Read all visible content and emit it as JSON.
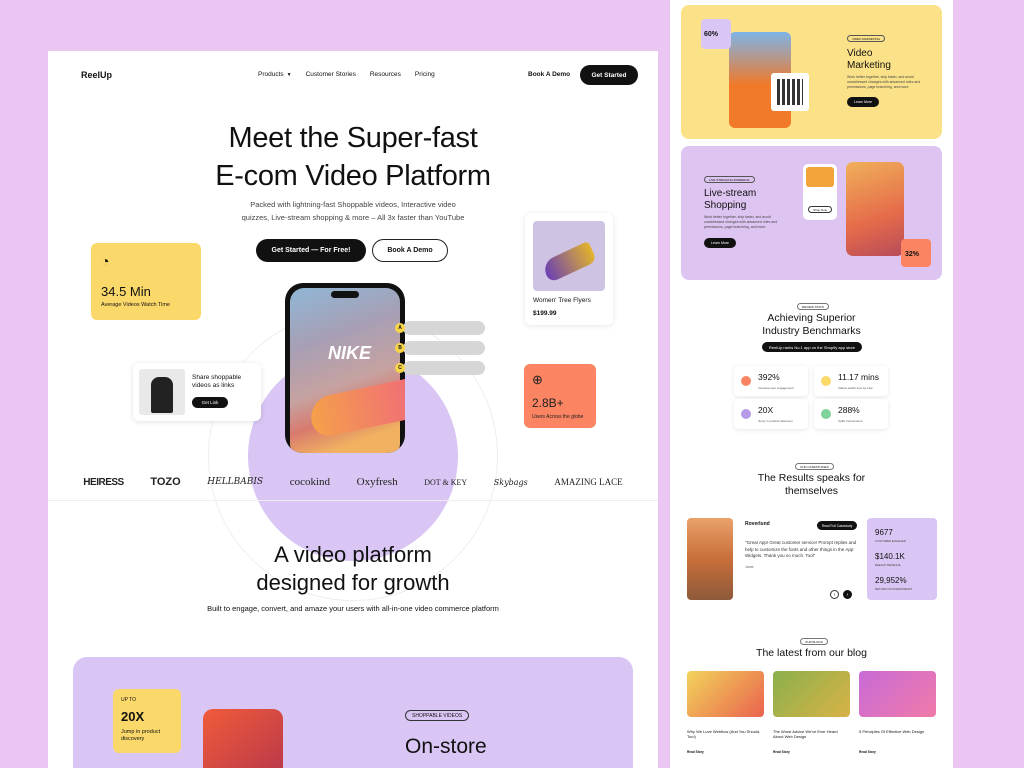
{
  "nav": {
    "logo": "ReelUp",
    "links": [
      "Products",
      "Customer Stories",
      "Resources",
      "Pricing"
    ],
    "demo": "Book A Demo",
    "cta": "Get Started"
  },
  "hero": {
    "title_line1": "Meet the Super-fast",
    "title_line2": "E-com Video Platform",
    "sub_line1": "Packed with lightning-fast Shoppable videos, Interactive video",
    "sub_line2": "quizzes, Live-stream shopping & more – All 3x faster than YouTube",
    "primary": "Get Started — For Free!",
    "secondary": "Book A Demo",
    "phone_brand": "NIKE",
    "options": [
      "A",
      "B",
      "C"
    ]
  },
  "stat_card": {
    "value": "34.5 Min",
    "label": "Average Videos Watch Time"
  },
  "product_card": {
    "name": "Women' Tree Flyers",
    "price": "$199.99"
  },
  "share_card": {
    "text": "Share shoppable videos as links",
    "button": "Get Link"
  },
  "users_card": {
    "value": "2.8B+",
    "label": "Users Across the globe"
  },
  "logos": [
    "HEIRESS",
    "TOZO",
    "HELLBABIS",
    "cocokind",
    "Oxyfresh",
    "DOT & KEY",
    "Skybags",
    "AMAZING LACE"
  ],
  "section2": {
    "title_line1": "A video platform",
    "title_line2": "designed for growth",
    "sub": "Built to engage, convert, and amaze your users with all-in-one video commerce platform"
  },
  "feature": {
    "up_to": "UP TO",
    "value": "20X",
    "label": "Jump in product discovery",
    "tag": "SHOPPABLE VIDEOS",
    "heading": "On-store"
  },
  "right": {
    "video": {
      "badge": "60%",
      "tag": "VIDEO MARKETING",
      "heading_line1": "Video",
      "heading_line2": "Marketing",
      "desc": "Work better together, ship faster, and avoid unaddressed changes with advanced roles and permissions, page branching, and more.",
      "button": "Learn More"
    },
    "live": {
      "tag": "LIVE STREAM ECOMMERCE",
      "heading_line1": "Live-stream",
      "heading_line2": "Shopping",
      "desc": "Work better together, ship faster, and avoid unaddressed changes with advanced roles and permissions, page branching, and more.",
      "button": "Learn More",
      "mini_label": "Shop Now",
      "pct": "32%"
    },
    "bench": {
      "tag": "REVIEW STATS",
      "title_line1": "Achieving Superior",
      "title_line2": "Industry Benchmarks",
      "rank": "ReelUp ranks No.1 app on the Shopify app store",
      "items": [
        {
          "value": "392%",
          "label": "Increase user engagement",
          "color": "#fb8462"
        },
        {
          "value": "11.17 mins",
          "label": "Videos watch time by Like",
          "color": "#fbd86a"
        },
        {
          "value": "20X",
          "label": "Jump in product discovery",
          "color": "#b89be8"
        },
        {
          "value": "288%",
          "label": "Uplift Conversions",
          "color": "#7ed39a"
        }
      ]
    },
    "results": {
      "tag": "OUR CASESTUDIES",
      "title_line1": "The Results speaks for",
      "title_line2": "themselves",
      "brand": "Roverlund",
      "case_study": "Read Full Casestudy",
      "quote": "\"Great App! Great customer service! Prompt replies and help to customize the fonts and other things in the App Widgets. Thank you so much. Tool\"",
      "author": "Jame",
      "stats": [
        {
          "value": "9677",
          "label": "CUSTOMER ENGAGED"
        },
        {
          "value": "$140.1K",
          "label": "REELUP REVENUE"
        },
        {
          "value": "29,952%",
          "label": "RETURN ON INVESTMENTS"
        }
      ]
    },
    "blog": {
      "tag": "OUR BLOGS",
      "title": "The latest from our blog",
      "posts": [
        {
          "title": "Why We Love Webflow (And You Should, Too!)",
          "read": "Read Story"
        },
        {
          "title": "The Worst Advice We've Ever Heard About Web Design",
          "read": "Read Story"
        },
        {
          "title": "5 Principles Of Effective Web Design",
          "read": "Read Story"
        }
      ]
    }
  }
}
